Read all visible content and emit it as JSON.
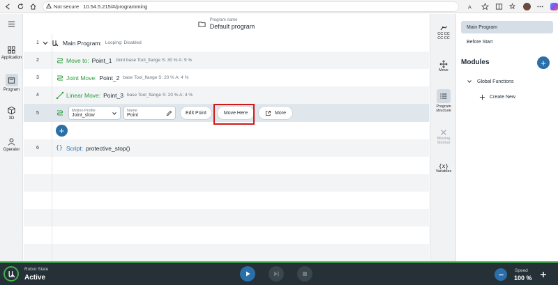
{
  "browser": {
    "security_label": "Not secure",
    "url": "10.54.5.215/#/programming"
  },
  "left_nav": [
    {
      "label": "Application"
    },
    {
      "label": "Program"
    },
    {
      "label": "3D"
    },
    {
      "label": "Operator"
    }
  ],
  "header": {
    "caption": "Program name",
    "name": "Default program"
  },
  "tree": {
    "main": {
      "num": "1",
      "label": "Main Program:",
      "meta": "Looping: Disabled"
    },
    "rows": [
      {
        "num": "2",
        "type": "Move to:",
        "target": "Point_1",
        "meta": "Joint  base  Tool_flange  S: 30 %  A: 9 %"
      },
      {
        "num": "3",
        "type": "Joint Move:",
        "target": "Point_2",
        "meta": "base  Tool_flange  S: 20 %  A: 4 %"
      },
      {
        "num": "4",
        "type": "Linear Move:",
        "target": "Point_3",
        "meta": "base  Tool_flange  S: 20 %  A: 4 %"
      }
    ],
    "edit_row": {
      "num": "5",
      "motion_profile_caption": "Motion Profile",
      "motion_profile_value": "Joint_slow",
      "name_caption": "Name",
      "name_value": "Point",
      "edit_point_label": "Edit Point",
      "move_here_label": "Move Here",
      "more_label": "More"
    },
    "script": {
      "num": "6",
      "type": "Script:",
      "name": "protective_stop()"
    }
  },
  "side_panel": {
    "cc_label": "CC CC\nCC CC",
    "move_label": "Move",
    "program_structure_label": "Program structure",
    "missing_sidebar_label": "Missing Sidebar",
    "variables_label": "Variables",
    "variables_glyph": "{x}"
  },
  "modules": {
    "main_program": "Main Program",
    "before_start": "Before Start",
    "title": "Modules",
    "global_functions": "Global Functions",
    "create_new": "Create New"
  },
  "footer": {
    "state_caption": "Robot State",
    "state_value": "Active",
    "speed_caption": "Speed",
    "speed_value": "100 %"
  },
  "colors": {
    "accent": "#2a6fa8",
    "node_green": "#2b9c3a",
    "footer_bg": "#253037",
    "footer_border": "#3fb24b",
    "highlight": "#d01919"
  }
}
